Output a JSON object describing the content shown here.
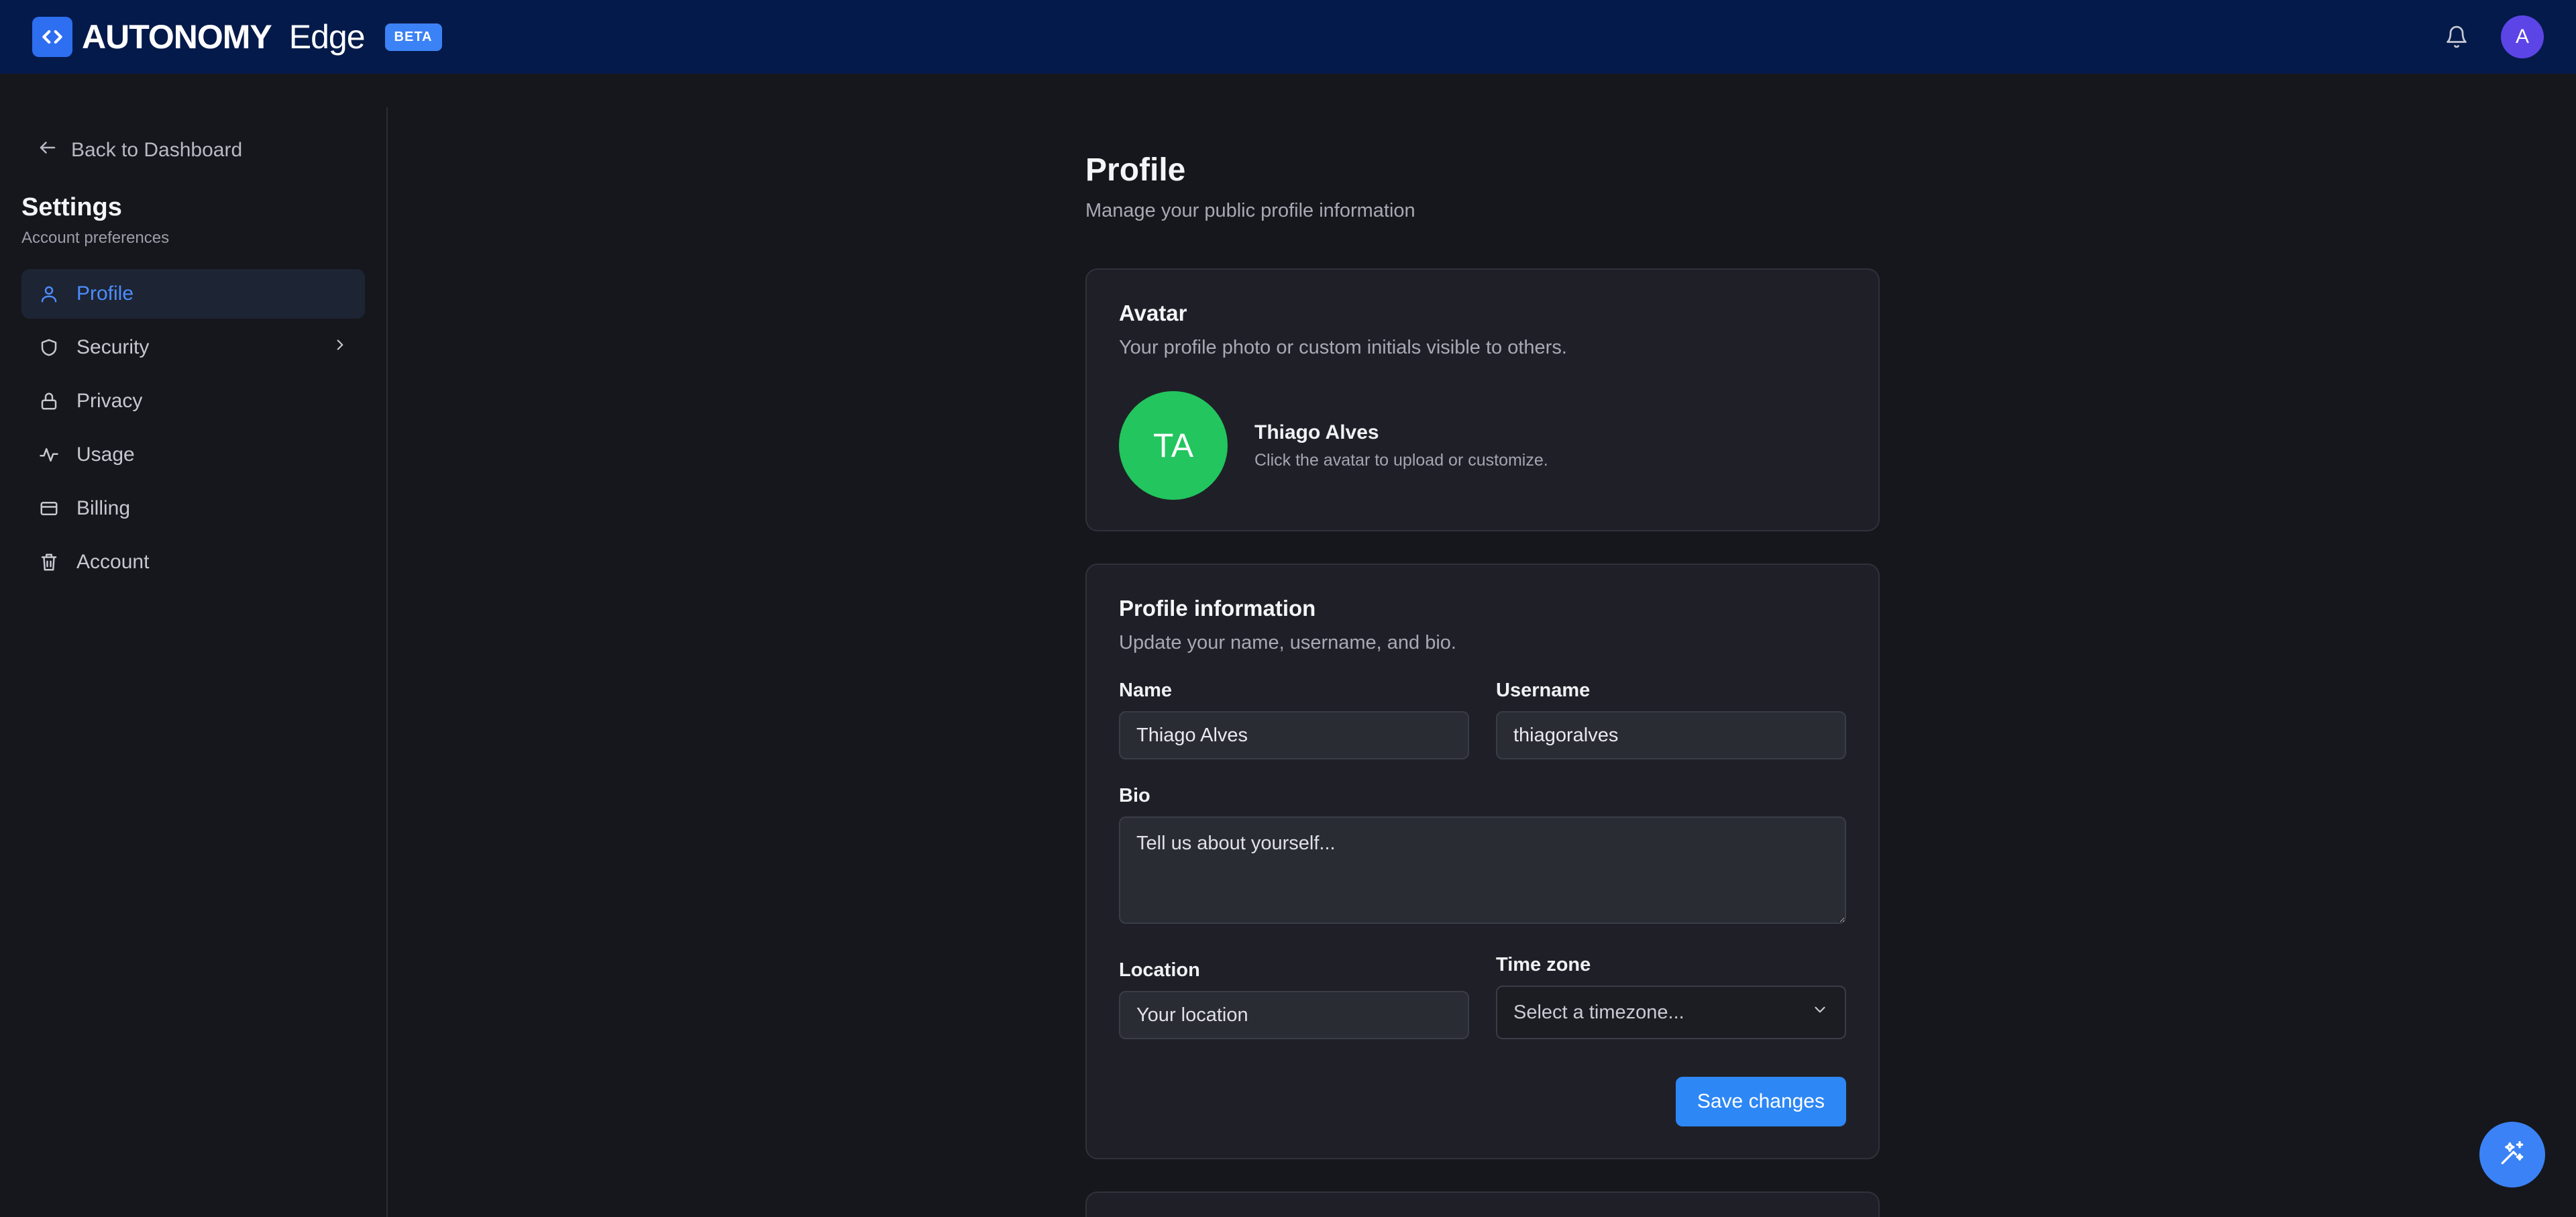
{
  "header": {
    "brand_name": "AUTONOMY",
    "brand_sub": "Edge",
    "beta_badge": "BETA",
    "user_initial": "A",
    "avatar_color": "#5b45e6"
  },
  "sidebar": {
    "back_label": "Back to Dashboard",
    "title": "Settings",
    "subtitle": "Account preferences",
    "items": [
      {
        "label": "Profile",
        "icon": "user-icon",
        "active": true
      },
      {
        "label": "Security",
        "icon": "shield-icon",
        "has_submenu": true
      },
      {
        "label": "Privacy",
        "icon": "lock-icon"
      },
      {
        "label": "Usage",
        "icon": "activity-icon"
      },
      {
        "label": "Billing",
        "icon": "credit-card-icon"
      },
      {
        "label": "Account",
        "icon": "trash-icon"
      }
    ]
  },
  "main": {
    "title": "Profile",
    "subtitle": "Manage your public profile information",
    "avatar_card": {
      "title": "Avatar",
      "description": "Your profile photo or custom initials visible to others.",
      "initials": "TA",
      "name": "Thiago Alves",
      "hint": "Click the avatar to upload or customize.",
      "avatar_color": "#22c55e"
    },
    "info_card": {
      "title": "Profile information",
      "description": "Update your name, username, and bio.",
      "name_label": "Name",
      "name_value": "Thiago Alves",
      "username_label": "Username",
      "username_value": "thiagoralves",
      "bio_label": "Bio",
      "bio_placeholder": "Tell us about yourself...",
      "location_label": "Location",
      "location_placeholder": "Your location",
      "timezone_label": "Time zone",
      "timezone_placeholder": "Select a timezone...",
      "save_label": "Save changes"
    }
  },
  "colors": {
    "accent": "#2d87f5",
    "topbar": "#041a4a",
    "background": "#16171c"
  }
}
